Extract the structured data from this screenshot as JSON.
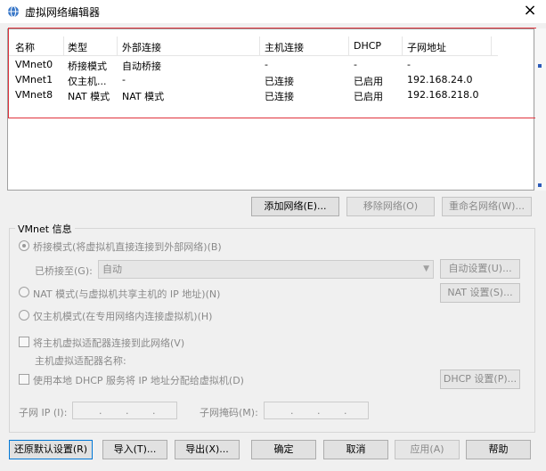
{
  "window": {
    "title": "虚拟网络编辑器",
    "close_glyph": "×"
  },
  "table": {
    "headers": [
      "名称",
      "类型",
      "外部连接",
      "主机连接",
      "DHCP",
      "子网地址"
    ],
    "rows": [
      [
        "VMnet0",
        "桥接模式",
        "自动桥接",
        "-",
        "-",
        "-"
      ],
      [
        "VMnet1",
        "仅主机...",
        "-",
        "已连接",
        "已启用",
        "192.168.24.0"
      ],
      [
        "VMnet8",
        "NAT 模式",
        "NAT 模式",
        "已连接",
        "已启用",
        "192.168.218.0"
      ]
    ]
  },
  "list_buttons": {
    "add": "添加网络(E)...",
    "remove": "移除网络(O)",
    "rename": "重命名网络(W)..."
  },
  "vmnet_info": {
    "label": "VMnet 信息",
    "bridged": "桥接模式(将虚拟机直接连接到外部网络)(B)",
    "bridged_to_label": "已桥接至(G):",
    "bridged_to_value": "自动",
    "auto_settings": "自动设置(U)...",
    "nat": "NAT 模式(与虚拟机共享主机的 IP 地址)(N)",
    "nat_settings": "NAT 设置(S)...",
    "host_only": "仅主机模式(在专用网络内连接虚拟机)(H)",
    "connect_adapter": "将主机虚拟适配器连接到此网络(V)",
    "adapter_name": "主机虚拟适配器名称:",
    "use_dhcp": "使用本地 DHCP 服务将 IP 地址分配给虚拟机(D)",
    "dhcp_settings": "DHCP 设置(P)...",
    "subnet_ip": "子网 IP (I):",
    "subnet_mask": "子网掩码(M):"
  },
  "bottom_buttons": {
    "restore": "还原默认设置(R)",
    "import": "导入(T)...",
    "export": "导出(X)...",
    "ok": "确定",
    "cancel": "取消",
    "apply": "应用(A)",
    "help": "帮助"
  },
  "colors": {
    "highlight": "#e0323c",
    "focus": "#0078d7"
  },
  "icons": {
    "title": "network-globe-icon",
    "dropdown": "chevron-down-icon"
  }
}
